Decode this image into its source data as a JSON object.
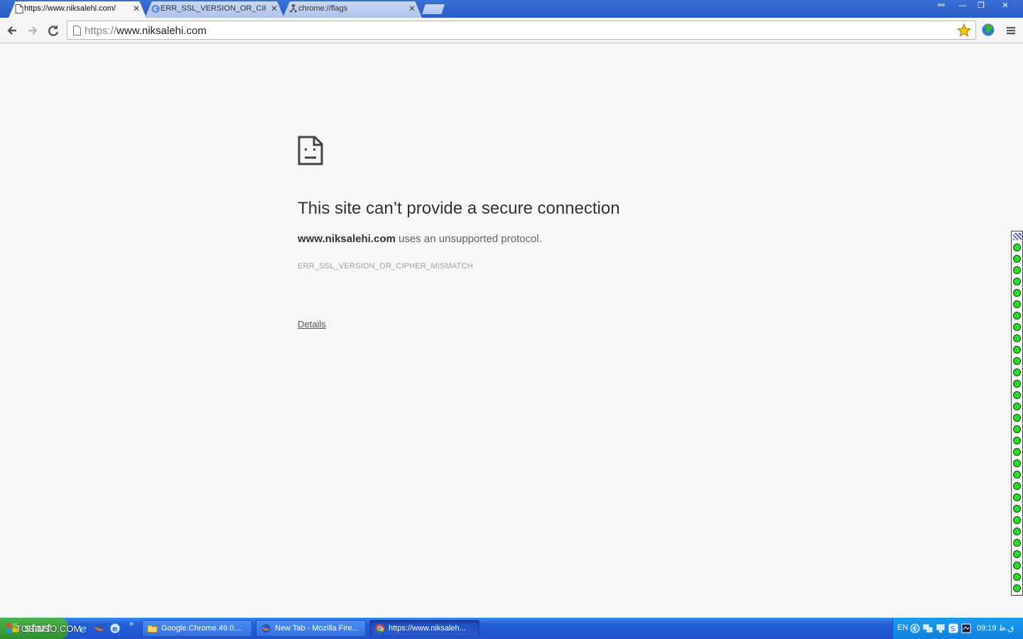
{
  "browser": {
    "tabs": [
      {
        "title": "https://www.niksalehi.com/",
        "active": true,
        "icon": "page-icon"
      },
      {
        "title": "ERR_SSL_VERSION_OR_CIPHER_MISMATCH",
        "active": false,
        "icon": "google-icon"
      },
      {
        "title": "chrome://flags",
        "active": false,
        "icon": "radiation-icon"
      }
    ],
    "omnibox": {
      "scheme": "https://",
      "host": "www.niksalehi.com"
    }
  },
  "error_page": {
    "title": "This site can’t provide a secure connection",
    "domain": "www.niksalehi.com",
    "message": " uses an unsupported protocol.",
    "code": "ERR_SSL_VERSION_OR_CIPHER_MISMATCH",
    "details_link": "Details"
  },
  "taskbar": {
    "start_label": "start",
    "watermark": "TOSINSO.COM",
    "items": [
      {
        "label": "Google.Chrome.49.0....",
        "icon": "folder-icon",
        "active": false
      },
      {
        "label": "New Tab - Mozilla Fire...",
        "icon": "firefox-icon",
        "active": false
      },
      {
        "label": "https://www.niksaleh...",
        "icon": "chrome-icon",
        "active": true
      }
    ],
    "tray": {
      "language": "EN",
      "clock": "09:19 ق.ظ"
    }
  },
  "colors": {
    "xp_blue": "#245edb",
    "start_green": "#3a9c3a",
    "indicator_green": "#2cdc2c"
  }
}
